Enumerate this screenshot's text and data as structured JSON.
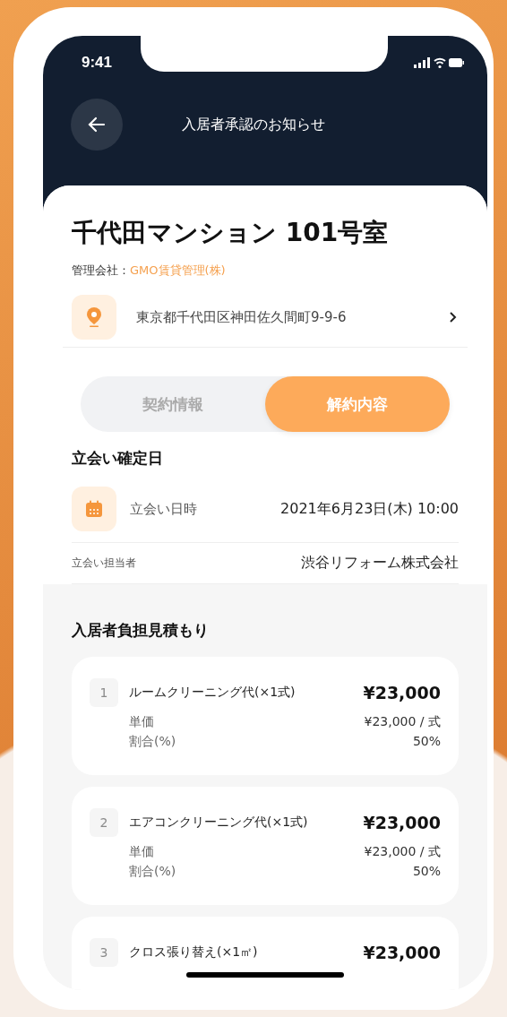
{
  "status_bar": {
    "time": "9:41"
  },
  "header": {
    "title": "入居者承認のお知らせ"
  },
  "property": {
    "name": "千代田マンション 101号室",
    "manager_label": "管理会社：",
    "manager": "GMO賃貸管理(株)",
    "address": "東京都千代田区神田佐久間町9-9-6"
  },
  "tabs": [
    {
      "label": "契約情報",
      "selected": false
    },
    {
      "label": "解約内容",
      "selected": true
    }
  ],
  "inspection": {
    "heading": "立会い確定日",
    "rows": [
      {
        "kind": "icon",
        "label": "立会い日時",
        "value": "2021年6月23日(木) 10:00"
      },
      {
        "kind": "plain",
        "label": "立会い担当者",
        "value": "渋谷リフォーム株式会社"
      }
    ]
  },
  "estimate": {
    "heading": "入居者負担見積もり",
    "items": [
      {
        "number": "1",
        "name": "ルームクリーニング代(×1式)",
        "amount": "¥23,000",
        "details": [
          {
            "label": "単価",
            "value": "¥23,000 / 式"
          },
          {
            "label": "割合(%)",
            "value": "50%"
          }
        ]
      },
      {
        "number": "2",
        "name": "エアコンクリーニング代(×1式)",
        "amount": "¥23,000",
        "details": [
          {
            "label": "単価",
            "value": "¥23,000 / 式"
          },
          {
            "label": "割合(%)",
            "value": "50%"
          }
        ]
      },
      {
        "number": "3",
        "name": "クロス張り替え(×1㎡)",
        "amount": "¥23,000"
      }
    ]
  }
}
